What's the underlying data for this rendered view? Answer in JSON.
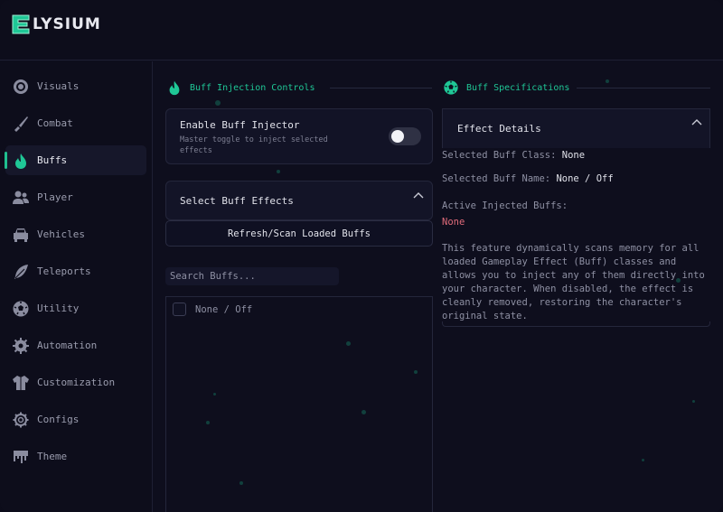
{
  "app": {
    "title": "LYSIUM",
    "logo_letter": "E",
    "accent": "#1fc796"
  },
  "sidebar": {
    "items": [
      {
        "label": "Visuals",
        "icon": "eye-icon"
      },
      {
        "label": "Combat",
        "icon": "knife-icon"
      },
      {
        "label": "Buffs",
        "icon": "flame-icon",
        "active": true
      },
      {
        "label": "Player",
        "icon": "players-icon"
      },
      {
        "label": "Vehicles",
        "icon": "car-icon"
      },
      {
        "label": "Teleports",
        "icon": "feather-icon"
      },
      {
        "label": "Utility",
        "icon": "ball-icon"
      },
      {
        "label": "Automation",
        "icon": "cog-spiky-icon"
      },
      {
        "label": "Customization",
        "icon": "jacket-icon"
      },
      {
        "label": "Configs",
        "icon": "gear-icon"
      },
      {
        "label": "Theme",
        "icon": "paint-drip-icon"
      }
    ]
  },
  "left": {
    "section_title": "Buff Injection Controls",
    "toggle": {
      "title": "Enable Buff Injector",
      "description": "Master toggle to inject selected effects",
      "enabled": false
    },
    "effects_panel": {
      "title": "Select Buff Effects",
      "refresh_label": "Refresh/Scan Loaded Buffs",
      "search_placeholder": "Search Buffs...",
      "search_value": "",
      "options": [
        {
          "label": "None / Off",
          "checked": false
        }
      ]
    }
  },
  "right": {
    "section_title": "Buff Specifications",
    "details": {
      "title": "Effect Details",
      "class_label": "Selected Buff Class:",
      "class_value": "None",
      "name_label": "Selected Buff Name:",
      "name_value": "None / Off",
      "active_label": "Active Injected Buffs:",
      "active_value": "None",
      "description": "This feature dynamically scans memory for all\nloaded Gameplay Effect (Buff) classes and\nallows you to inject any of them directly into\nyour character. When disabled, the effect is\ncleanly removed, restoring the character's\noriginal state."
    }
  }
}
